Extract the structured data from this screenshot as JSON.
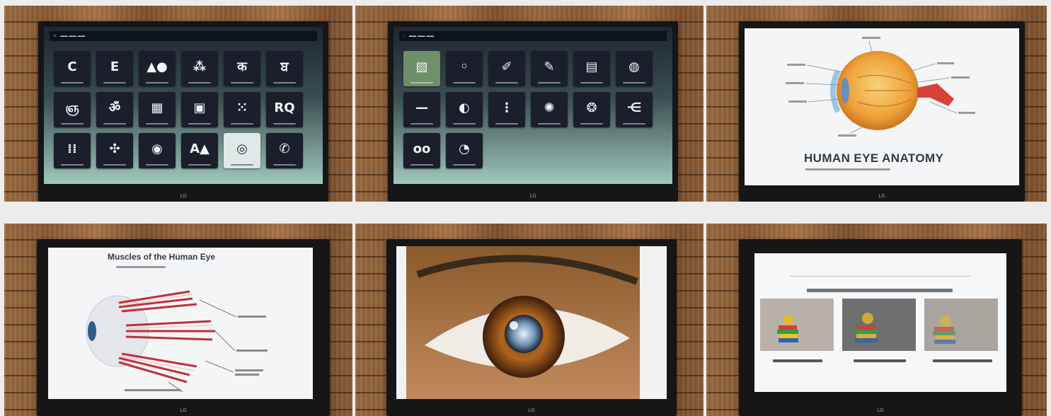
{
  "monitor_brand": "LG",
  "panels": {
    "eye_anatomy": {
      "title": "HUMAN EYE ANATOMY"
    },
    "eye_muscles": {
      "title": "Muscles of the Human Eye"
    }
  },
  "launcher_a": {
    "tiles": [
      {
        "glyph": "C"
      },
      {
        "glyph": "E"
      },
      {
        "glyph": "▲●"
      },
      {
        "glyph": "⁂"
      },
      {
        "glyph": "क"
      },
      {
        "glyph": "ਬ"
      },
      {
        "glyph": "ஞ"
      },
      {
        "glyph": "ॐ"
      },
      {
        "glyph": "▦"
      },
      {
        "glyph": "▣"
      },
      {
        "glyph": "⁙"
      },
      {
        "glyph": "RQ"
      },
      {
        "glyph": "⁞⁞"
      },
      {
        "glyph": "✣"
      },
      {
        "glyph": "◉"
      },
      {
        "glyph": "A▲"
      },
      {
        "glyph": "◎"
      },
      {
        "glyph": "✆"
      }
    ]
  },
  "launcher_b": {
    "tiles": [
      {
        "glyph": "▨"
      },
      {
        "glyph": "◦"
      },
      {
        "glyph": "✐"
      },
      {
        "glyph": "✎"
      },
      {
        "glyph": "▤"
      },
      {
        "glyph": "◍"
      },
      {
        "glyph": "—"
      },
      {
        "glyph": "◐"
      },
      {
        "glyph": "⋮"
      },
      {
        "glyph": "✺"
      },
      {
        "glyph": "❂"
      },
      {
        "glyph": "⋲"
      },
      {
        "glyph": "oo"
      },
      {
        "glyph": "◔"
      }
    ]
  },
  "colors": {
    "wood": "#9a6a40",
    "monitor": "#161616",
    "launcher_top": "#1e2630",
    "launcher_bottom": "#9fc7bd",
    "tile": "#1b1f2c",
    "iris": "#b0651f",
    "muscle_red": "#c0303a"
  }
}
